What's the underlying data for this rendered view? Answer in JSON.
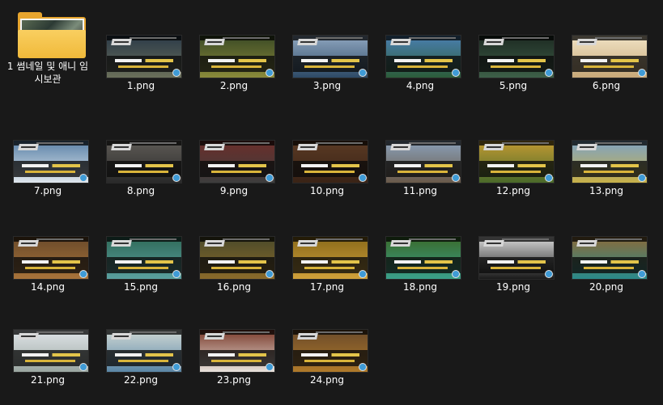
{
  "folder": {
    "name": "1 썸네일 및 애니 임시보관",
    "icon": "folder-icon"
  },
  "files": [
    {
      "name": "1.png",
      "sky": [
        "#2b3a48",
        "#6a6f5a"
      ]
    },
    {
      "name": "2.png",
      "sky": [
        "#3b4a25",
        "#8a8a3a"
      ]
    },
    {
      "name": "3.png",
      "sky": [
        "#8fa6c0",
        "#2d4a66"
      ]
    },
    {
      "name": "4.png",
      "sky": [
        "#4a7fb0",
        "#2c5d3a"
      ]
    },
    {
      "name": "5.png",
      "sky": [
        "#1d2a22",
        "#3d5f48"
      ]
    },
    {
      "name": "6.png",
      "sky": [
        "#f0e2c4",
        "#c7a878"
      ]
    },
    {
      "name": "7.png",
      "sky": [
        "#5b82a8",
        "#dfe6ec"
      ]
    },
    {
      "name": "8.png",
      "sky": [
        "#5d5a55",
        "#2a2a2a"
      ]
    },
    {
      "name": "9.png",
      "sky": [
        "#6b2e2a",
        "#3d3d3d"
      ]
    },
    {
      "name": "10.png",
      "sky": [
        "#5a3a24",
        "#3a2316"
      ]
    },
    {
      "name": "11.png",
      "sky": [
        "#8aa0b8",
        "#6a5a4a"
      ]
    },
    {
      "name": "12.png",
      "sky": [
        "#c29a32",
        "#4a6a2a"
      ]
    },
    {
      "name": "13.png",
      "sky": [
        "#7fa3c4",
        "#c7b048"
      ]
    },
    {
      "name": "14.png",
      "sky": [
        "#6a4a2a",
        "#a8733a"
      ]
    },
    {
      "name": "15.png",
      "sky": [
        "#2f6a58",
        "#5aa0a0"
      ]
    },
    {
      "name": "16.png",
      "sky": [
        "#4a4a2a",
        "#8a6a2a"
      ]
    },
    {
      "name": "17.png",
      "sky": [
        "#8a6a1a",
        "#d0a03a"
      ]
    },
    {
      "name": "18.png",
      "sky": [
        "#3a6a2a",
        "#3aa08a"
      ]
    },
    {
      "name": "19.png",
      "sky": [
        "#d8d8d8",
        "#1a1a1a"
      ]
    },
    {
      "name": "20.png",
      "sky": [
        "#8a6a3a",
        "#2a8a8a"
      ]
    },
    {
      "name": "21.png",
      "sky": [
        "#dfe4e8",
        "#9aa6a0"
      ]
    },
    {
      "name": "22.png",
      "sky": [
        "#cfd8d4",
        "#5a86a6"
      ]
    },
    {
      "name": "23.png",
      "sky": [
        "#7a3a2a",
        "#e8e2dc"
      ]
    },
    {
      "name": "24.png",
      "sky": [
        "#6a4a2a",
        "#b07a2a"
      ]
    }
  ]
}
